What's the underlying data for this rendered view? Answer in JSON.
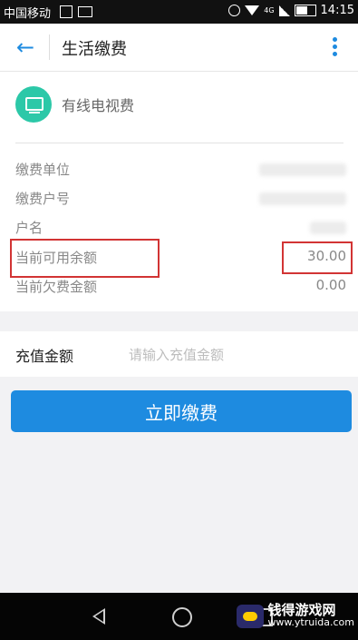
{
  "status_bar": {
    "carrier": "中国移动",
    "network": "4G",
    "time": "14:15"
  },
  "app_bar": {
    "title": "生活缴费"
  },
  "service": {
    "name": "有线电视费",
    "icon": "tv-icon",
    "icon_color": "#2cc8a8"
  },
  "details": [
    {
      "label": "缴费单位",
      "value": ""
    },
    {
      "label": "缴费户号",
      "value": ""
    },
    {
      "label": "户名",
      "value": ""
    },
    {
      "label": "当前可用余额",
      "value": "30.00"
    },
    {
      "label": "当前欠费金额",
      "value": "0.00"
    }
  ],
  "recharge": {
    "label": "充值金额",
    "placeholder": "请输入充值金额"
  },
  "pay_button": {
    "label": "立即缴费"
  },
  "watermark": {
    "name": "钱得游戏网",
    "url": "www.ytruida.com"
  },
  "colors": {
    "accent": "#1e8be0",
    "highlight": "#d23434"
  }
}
